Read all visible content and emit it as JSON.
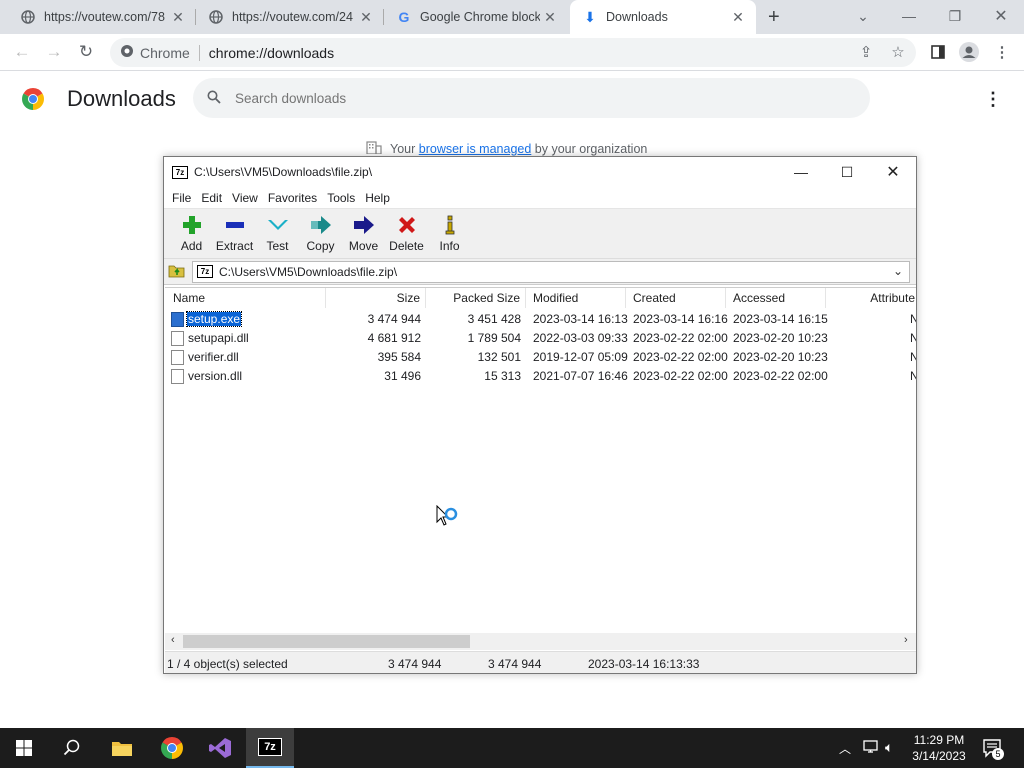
{
  "browser": {
    "tabs": [
      {
        "title": "https://voutew.com/78",
        "active": false
      },
      {
        "title": "https://voutew.com/24",
        "active": false
      },
      {
        "title": "Google Chrome blocks",
        "active": false
      },
      {
        "title": "Downloads",
        "active": true
      }
    ],
    "new_tab_label": "+",
    "omnibox": {
      "chip": "Chrome",
      "url": "chrome://downloads"
    }
  },
  "downloads_page": {
    "title": "Downloads",
    "search_placeholder": "Search downloads",
    "managed_prefix": "Your",
    "managed_link": "browser is managed",
    "managed_suffix": "by your organization"
  },
  "zip_window": {
    "title": "C:\\Users\\VM5\\Downloads\\file.zip\\",
    "menu": [
      "File",
      "Edit",
      "View",
      "Favorites",
      "Tools",
      "Help"
    ],
    "toolbar": [
      {
        "label": "Add",
        "icon": "plus-icon",
        "color": "#22a32a"
      },
      {
        "label": "Extract",
        "icon": "minus-icon",
        "color": "#1a2fb8"
      },
      {
        "label": "Test",
        "icon": "check-icon",
        "color": "#1ab0c8"
      },
      {
        "label": "Copy",
        "icon": "double-arrow-icon",
        "color": "#1a8a8a"
      },
      {
        "label": "Move",
        "icon": "arrow-right-icon",
        "color": "#1a1a8a"
      },
      {
        "label": "Delete",
        "icon": "x-icon",
        "color": "#d01818"
      },
      {
        "label": "Info",
        "icon": "info-icon",
        "color": "#c8a800"
      }
    ],
    "address": "C:\\Users\\VM5\\Downloads\\file.zip\\",
    "columns": [
      "Name",
      "Size",
      "Packed Size",
      "Modified",
      "Created",
      "Accessed",
      "Attribute"
    ],
    "files": [
      {
        "name": "setup.exe",
        "size": "3 474 944",
        "packed": "3 451 428",
        "modified": "2023-03-14 16:13",
        "created": "2023-03-14 16:16",
        "accessed": "2023-03-14 16:15",
        "attr": "N",
        "selected": true
      },
      {
        "name": "setupapi.dll",
        "size": "4 681 912",
        "packed": "1 789 504",
        "modified": "2022-03-03 09:33",
        "created": "2023-02-22 02:00",
        "accessed": "2023-02-20 10:23",
        "attr": "N",
        "selected": false
      },
      {
        "name": "verifier.dll",
        "size": "395 584",
        "packed": "132 501",
        "modified": "2019-12-07 05:09",
        "created": "2023-02-22 02:00",
        "accessed": "2023-02-20 10:23",
        "attr": "N",
        "selected": false
      },
      {
        "name": "version.dll",
        "size": "31 496",
        "packed": "15 313",
        "modified": "2021-07-07 16:46",
        "created": "2023-02-22 02:00",
        "accessed": "2023-02-22 02:00",
        "attr": "N",
        "selected": false
      }
    ],
    "status": {
      "selection": "1 / 4 object(s) selected",
      "size": "3 474 944",
      "packed": "3 474 944",
      "modified": "2023-03-14 16:13:33"
    }
  },
  "taskbar": {
    "time": "11:29 PM",
    "date": "3/14/2023",
    "notification_count": "5"
  }
}
